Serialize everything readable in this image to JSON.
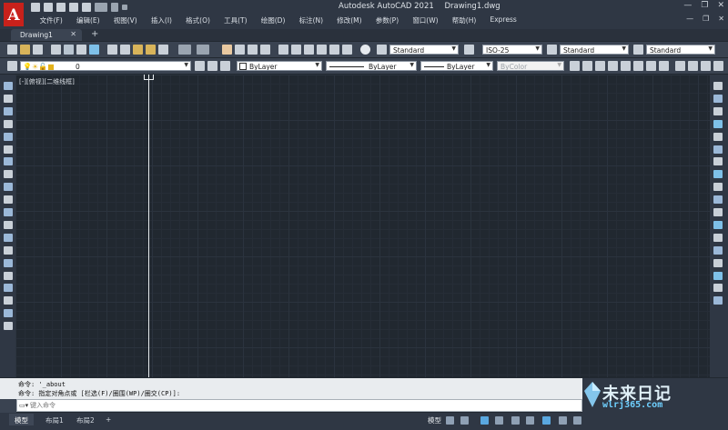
{
  "app": {
    "title": "Autodesk AutoCAD 2021",
    "document": "Drawing1.dwg",
    "brand_color": "#c8211b",
    "accent_color": "#3a4351"
  },
  "menu": [
    "文件(F)",
    "编辑(E)",
    "视图(V)",
    "插入(I)",
    "格式(O)",
    "工具(T)",
    "绘图(D)",
    "标注(N)",
    "修改(M)",
    "参数(P)",
    "窗口(W)",
    "帮助(H)",
    "Express"
  ],
  "tabs": {
    "active": "Drawing1",
    "new_tab": "+"
  },
  "toolbar": {
    "text_style": "Standard",
    "dim_style": "ISO-25",
    "table_style": "Standard",
    "mleader_style": "Standard",
    "layer": "0",
    "color": "ByLayer",
    "linetype": "ByLayer",
    "lineweight": "ByLayer",
    "plot_style": "ByColor"
  },
  "viewport": {
    "label": "[-][俯视][二维线框]"
  },
  "command": {
    "history": [
      "命令: '_about",
      "命令: 指定对角点或 [栏选(F)/圈围(WP)/圈交(CP)]:"
    ],
    "placeholder": "键入命令"
  },
  "layout_tabs": [
    "模型",
    "布局1",
    "布局2"
  ],
  "status": {
    "model_label": "模型",
    "add_layout": "+"
  },
  "watermark": {
    "text": "未来日记",
    "url": "wlrj365.com"
  },
  "icons": {
    "left": [
      "line-icon",
      "xline-icon",
      "pline-icon",
      "polygon-icon",
      "rectangle-icon",
      "arc-icon",
      "circle-icon",
      "revcloud-icon",
      "spline-icon",
      "ellipse-icon",
      "ellipse-arc-icon",
      "insert-block-icon",
      "make-block-icon",
      "point-icon",
      "hatch-icon",
      "gradient-icon",
      "region-icon",
      "table-icon",
      "mtext-icon",
      "add-selected-icon"
    ],
    "right": [
      "erase-icon",
      "copy-icon",
      "mirror-icon",
      "offset-icon",
      "array-icon",
      "move-icon",
      "rotate-icon",
      "scale-icon",
      "stretch-icon",
      "trim-icon",
      "extend-icon",
      "break-at-point-icon",
      "break-icon",
      "join-icon",
      "chamfer-icon",
      "fillet-icon",
      "blend-icon",
      "explode-icon"
    ]
  }
}
